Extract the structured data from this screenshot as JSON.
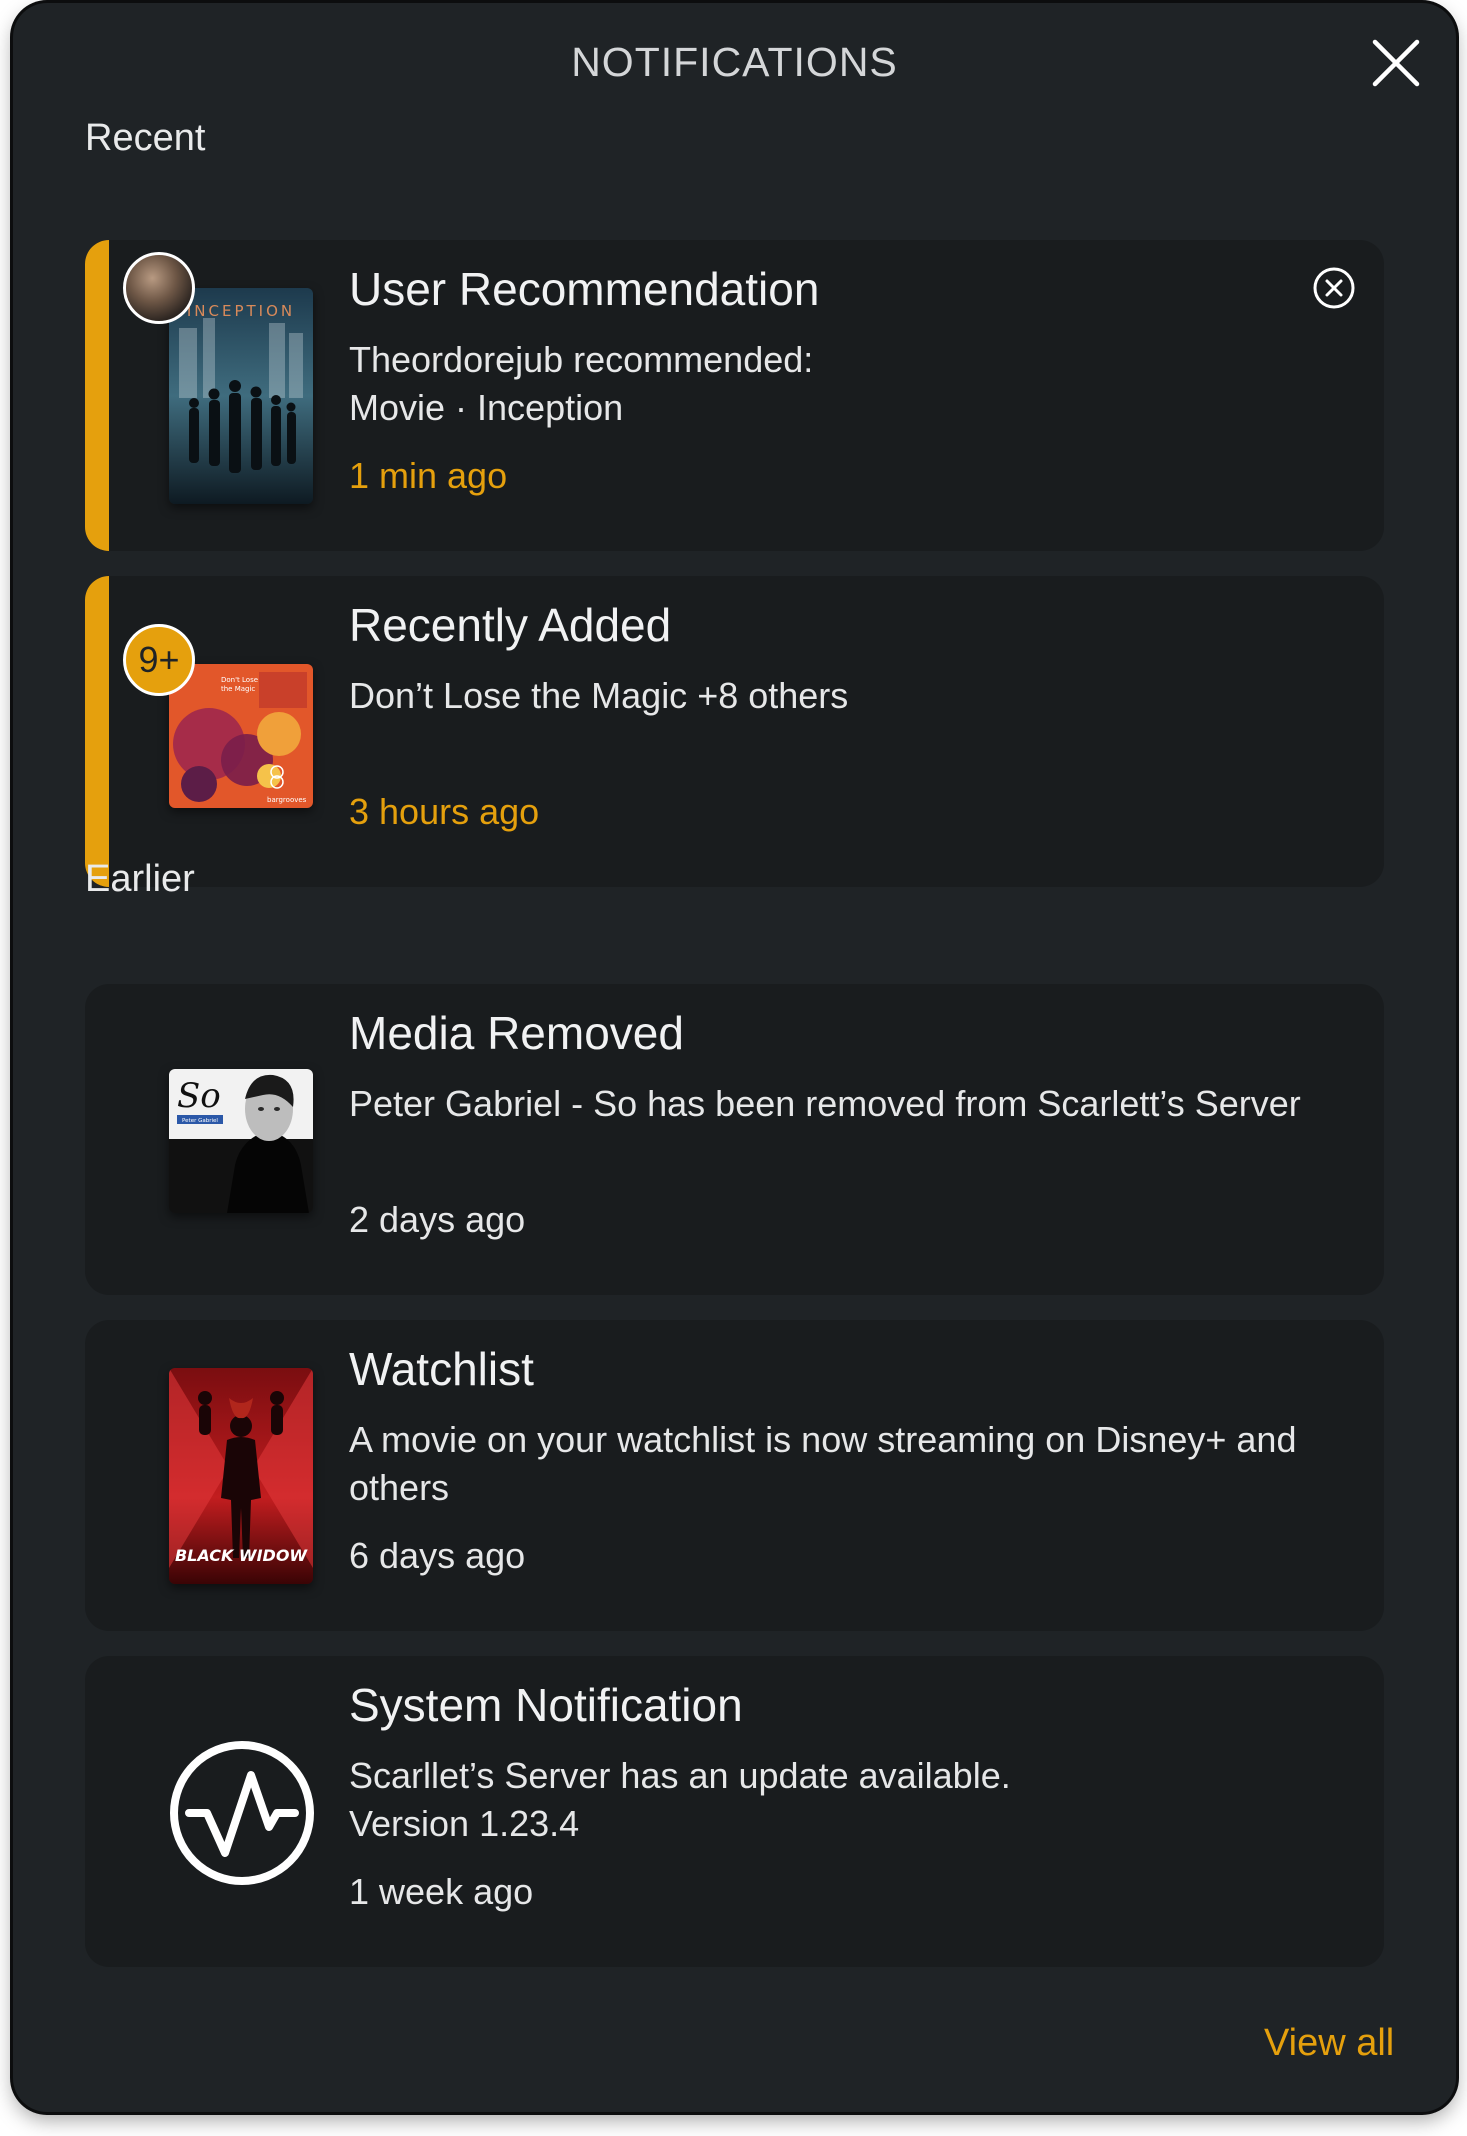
{
  "header": {
    "title": "NOTIFICATIONS"
  },
  "sections": {
    "recent_label": "Recent",
    "earlier_label": "Earlier"
  },
  "notifications": [
    {
      "title": "User Recommendation",
      "body_line1": "Theordorejub recommended:",
      "body_line2": "Movie · Inception",
      "time": "1 min ago",
      "thumbnail": "inception-poster",
      "poster_text": "INCEPTION",
      "unread": true,
      "dismiss_icon": "close-circle-icon"
    },
    {
      "title": "Recently Added",
      "body": "Don’t Lose the Magic +8 others",
      "time": "3 hours ago",
      "thumbnail": "dont-lose-the-magic-cover",
      "badge": "9+",
      "cover_text_1": "Don't Lose",
      "cover_text_2": "the Magic",
      "cover_text_3": "bargrooves",
      "unread": true
    },
    {
      "title": "Media Removed",
      "body": "Peter Gabriel - So has been removed from Scarlett’s Server",
      "time": "2 days ago",
      "thumbnail": "peter-gabriel-so-cover",
      "cover_title": "So",
      "cover_subtitle": "Peter Gabriel"
    },
    {
      "title": "Watchlist",
      "body": "A movie on your watchlist is now streaming on Disney+ and others",
      "time": "6 days ago",
      "thumbnail": "black-widow-poster",
      "poster_text": "BLACK WIDOW"
    },
    {
      "title": "System Notification",
      "body_line1": "Scarllet’s Server has an update available.",
      "body_line2": "Version 1.23.4",
      "time": "1 week ago",
      "thumbnail": "activity-pulse-icon"
    }
  ],
  "footer": {
    "view_all": "View all"
  },
  "colors": {
    "panel": "#1f2326",
    "card": "#191c1e",
    "accent": "#e5a00d",
    "text": "#e6e7e8"
  }
}
